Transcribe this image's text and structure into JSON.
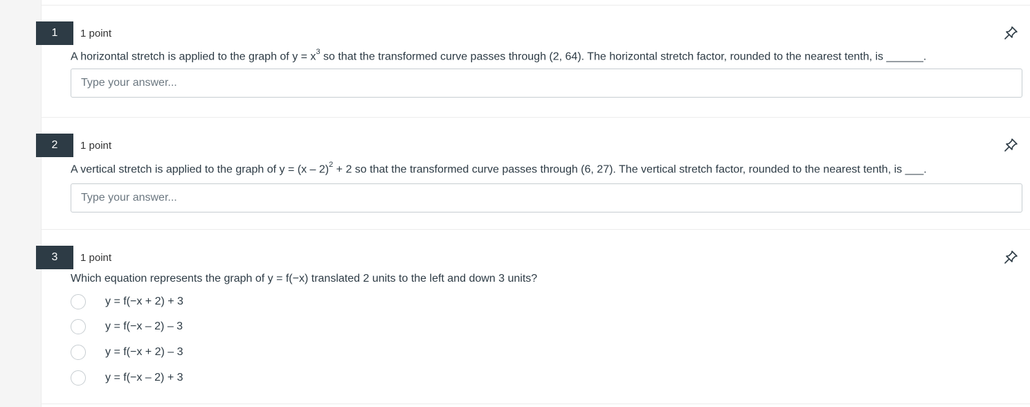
{
  "questions": [
    {
      "number": "1",
      "points": "1 point",
      "text_before": "A horizontal stretch is applied to the graph of y = x",
      "sup": "3",
      "text_after": " so that the transformed curve passes through (2, 64). The horizontal stretch factor, rounded to the nearest tenth, is ______.",
      "answer_placeholder": "Type your answer..."
    },
    {
      "number": "2",
      "points": "1 point",
      "text_before": "A vertical stretch is applied to the graph of y = (x – 2)",
      "sup": "2",
      "text_after": " + 2 so that the transformed curve passes through (6, 27). The vertical stretch factor, rounded to the nearest tenth, is ___.",
      "answer_placeholder": "Type your answer..."
    },
    {
      "number": "3",
      "points": "1 point",
      "text": "Which equation represents the graph of y = f(−x) translated 2 units to the left and down 3 units?",
      "options": [
        "y = f(−x + 2) + 3",
        "y = f(−x – 2) – 3",
        "y = f(−x + 2) – 3",
        "y = f(−x – 2) + 3"
      ]
    }
  ],
  "icons": {
    "pin": "pin-icon",
    "radio": "radio-circle"
  },
  "colors": {
    "number_badge": "#2d3b45",
    "text": "#2d3b45",
    "border": "#c7cdd1"
  }
}
